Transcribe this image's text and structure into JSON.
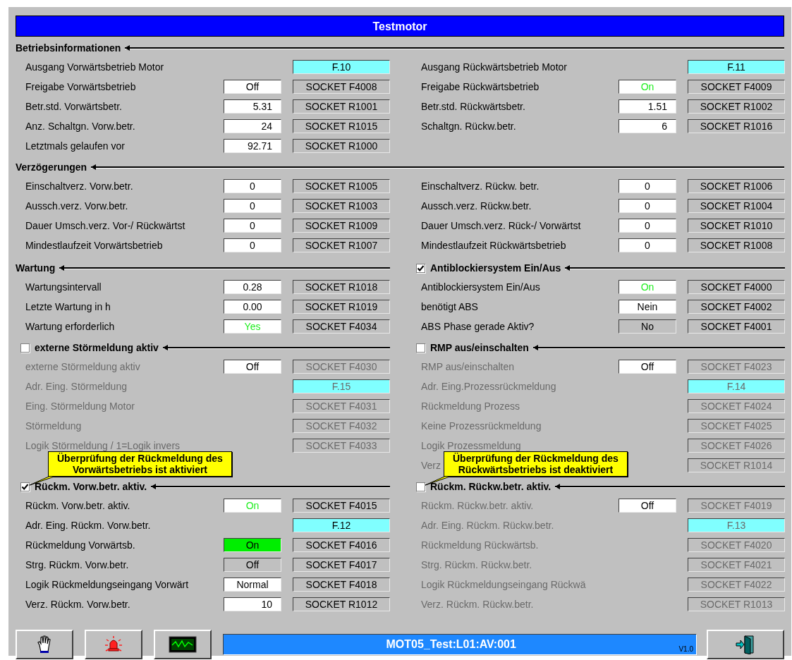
{
  "title": "Testmotor",
  "wide_sections": [
    {
      "title": "Betriebsinformationen",
      "left": [
        {
          "label": "Ausgang Vorwärtsbetrieb Motor",
          "disabled": false,
          "field": {
            "kind": "address",
            "text": "F.10"
          }
        },
        {
          "label": "Freigabe Vorwärtsbetrieb",
          "disabled": false,
          "value": {
            "kind": "text",
            "text": "Off"
          },
          "field": {
            "kind": "socket",
            "text": "SOCKET F4008"
          }
        },
        {
          "label": "Betr.std. Vorwärtsbetr.",
          "disabled": false,
          "value": {
            "kind": "number",
            "text": "5.31"
          },
          "field": {
            "kind": "socket",
            "text": "SOCKET R1001"
          }
        },
        {
          "label": "Anz. Schaltgn. Vorw.betr.",
          "disabled": false,
          "value": {
            "kind": "number",
            "text": "24"
          },
          "field": {
            "kind": "socket",
            "text": "SOCKET R1015"
          }
        },
        {
          "label": "Letztmals gelaufen vor",
          "disabled": false,
          "value": {
            "kind": "number",
            "text": "92.71"
          },
          "field": {
            "kind": "socket",
            "text": "SOCKET R1000"
          }
        }
      ],
      "right": [
        {
          "label": "Ausgang Rückwärtsbetrieb Motor",
          "disabled": false,
          "field": {
            "kind": "address",
            "text": "F.11"
          }
        },
        {
          "label": "Freigabe Rückwärtsbetrieb",
          "disabled": false,
          "value": {
            "kind": "on",
            "text": "On"
          },
          "field": {
            "kind": "socket",
            "text": "SOCKET F4009"
          }
        },
        {
          "label": "Betr.std. Rückwärtsbetr.",
          "disabled": false,
          "value": {
            "kind": "number",
            "text": "1.51"
          },
          "field": {
            "kind": "socket",
            "text": "SOCKET R1002"
          }
        },
        {
          "label": "Schaltgn. Rückw.betr.",
          "disabled": false,
          "value": {
            "kind": "number",
            "text": "6"
          },
          "field": {
            "kind": "socket",
            "text": "SOCKET R1016"
          }
        }
      ]
    },
    {
      "title": "Verzögerungen",
      "left": [
        {
          "label": "Einschaltverz. Vorw.betr.",
          "disabled": false,
          "value": {
            "kind": "text",
            "text": "0"
          },
          "field": {
            "kind": "socket",
            "text": "SOCKET R1005"
          }
        },
        {
          "label": "Aussch.verz. Vorw.betr.",
          "disabled": false,
          "value": {
            "kind": "text",
            "text": "0"
          },
          "field": {
            "kind": "socket",
            "text": "SOCKET R1003"
          }
        },
        {
          "label": "Dauer Umsch.verz. Vor-/ Rückwärtst",
          "disabled": false,
          "value": {
            "kind": "text",
            "text": "0"
          },
          "field": {
            "kind": "socket",
            "text": "SOCKET R1009"
          }
        },
        {
          "label": "Mindestlaufzeit Vorwärtsbetrieb",
          "disabled": false,
          "value": {
            "kind": "text",
            "text": "0"
          },
          "field": {
            "kind": "socket",
            "text": "SOCKET R1007"
          }
        }
      ],
      "right": [
        {
          "label": "Einschaltverz. Rückw. betr.",
          "disabled": false,
          "value": {
            "kind": "text",
            "text": "0"
          },
          "field": {
            "kind": "socket",
            "text": "SOCKET R1006"
          }
        },
        {
          "label": "Aussch.verz. Rückw.betr.",
          "disabled": false,
          "value": {
            "kind": "text",
            "text": "0"
          },
          "field": {
            "kind": "socket",
            "text": "SOCKET R1004"
          }
        },
        {
          "label": "Dauer Umsch.verz. Rück-/ Vorwärtst",
          "disabled": false,
          "value": {
            "kind": "text",
            "text": "0"
          },
          "field": {
            "kind": "socket",
            "text": "SOCKET R1010"
          }
        },
        {
          "label": "Mindestlaufzeit Rückwärtsbetrieb",
          "disabled": false,
          "value": {
            "kind": "text",
            "text": "0"
          },
          "field": {
            "kind": "socket",
            "text": "SOCKET R1008"
          }
        }
      ]
    }
  ],
  "left_sections": [
    {
      "title": "Wartung",
      "rows": [
        {
          "label": "Wartungsintervall",
          "disabled": false,
          "value": {
            "kind": "text",
            "text": "0.28"
          },
          "field": {
            "kind": "socket",
            "text": "SOCKET R1018"
          }
        },
        {
          "label": "Letzte Wartung in h",
          "disabled": false,
          "value": {
            "kind": "text",
            "text": "0.00"
          },
          "field": {
            "kind": "socket",
            "text": "SOCKET R1019"
          }
        },
        {
          "label": "Wartung erforderlich",
          "disabled": false,
          "value": {
            "kind": "on",
            "text": "Yes"
          },
          "field": {
            "kind": "socket",
            "text": "SOCKET F4034"
          }
        }
      ]
    },
    {
      "title": "externe Störmeldung aktiv",
      "checkbox": {
        "checked": false
      },
      "rows": [
        {
          "label": "externe Störmeldung aktiv",
          "disabled": true,
          "value": {
            "kind": "text",
            "text": "Off"
          },
          "field": {
            "kind": "socket",
            "text": "SOCKET F4030"
          }
        },
        {
          "label": "Adr. Eing. Störmeldung",
          "disabled": true,
          "field": {
            "kind": "address",
            "text": "F.15"
          }
        },
        {
          "label": "Eing. Störmeldung Motor",
          "disabled": true,
          "field": {
            "kind": "socket",
            "text": "SOCKET F4031"
          }
        },
        {
          "label": "Störmeldung",
          "disabled": true,
          "field": {
            "kind": "socket",
            "text": "SOCKET F4032"
          }
        },
        {
          "label": "Logik Störmeldung / 1=Logik invers",
          "disabled": true,
          "field": {
            "kind": "socket",
            "text": "SOCKET F4033"
          }
        }
      ]
    },
    {
      "title": "Rückm. Vorw.betr. aktiv.",
      "checkbox": {
        "checked": true
      },
      "callout": "Überprüfung der Rückmeldung des\nVorwärtsbetriebs ist aktiviert",
      "rows": [
        {
          "label": "Rückm. Vorw.betr. aktiv.",
          "disabled": false,
          "value": {
            "kind": "on",
            "text": "On"
          },
          "field": {
            "kind": "socket",
            "text": "SOCKET F4015"
          }
        },
        {
          "label": "Adr. Eing. Rückm. Vorw.betr.",
          "disabled": false,
          "field": {
            "kind": "address",
            "text": "F.12"
          }
        },
        {
          "label": "Rückmeldung Vorwärtsb.",
          "disabled": false,
          "value": {
            "kind": "active",
            "text": "On"
          },
          "field": {
            "kind": "socket",
            "text": "SOCKET F4016"
          }
        },
        {
          "label": "Strg. Rückm. Vorw.betr.",
          "disabled": false,
          "value": {
            "kind": "readonly",
            "text": "Off"
          },
          "field": {
            "kind": "socket",
            "text": "SOCKET F4017"
          }
        },
        {
          "label": "Logik Rückmeldungseingang Vorwärt",
          "disabled": false,
          "value": {
            "kind": "text",
            "text": "Normal"
          },
          "field": {
            "kind": "socket",
            "text": "SOCKET F4018"
          }
        },
        {
          "label": "Verz. Rückm. Vorw.betr.",
          "disabled": false,
          "value": {
            "kind": "number",
            "text": "10"
          },
          "field": {
            "kind": "socket",
            "text": "SOCKET R1012"
          }
        }
      ]
    }
  ],
  "right_sections": [
    {
      "title": "Antiblockiersystem Ein/Aus",
      "checkbox": {
        "checked": true
      },
      "rows": [
        {
          "label": "Antiblockiersystem Ein/Aus",
          "disabled": false,
          "value": {
            "kind": "on",
            "text": "On"
          },
          "field": {
            "kind": "socket",
            "text": "SOCKET F4000"
          }
        },
        {
          "label": "benötigt ABS",
          "disabled": false,
          "value": {
            "kind": "text",
            "text": "Nein"
          },
          "field": {
            "kind": "socket",
            "text": "SOCKET F4002"
          }
        },
        {
          "label": "ABS Phase gerade Aktiv?",
          "disabled": false,
          "value": {
            "kind": "readonly",
            "text": "No"
          },
          "field": {
            "kind": "socket",
            "text": "SOCKET F4001"
          }
        }
      ]
    },
    {
      "title": "RMP aus/einschalten",
      "checkbox": {
        "checked": false
      },
      "rows": [
        {
          "label": "RMP aus/einschalten",
          "disabled": true,
          "value": {
            "kind": "text",
            "text": "Off"
          },
          "field": {
            "kind": "socket",
            "text": "SOCKET F4023"
          }
        },
        {
          "label": "Adr. Eing.Prozessrückmeldung",
          "disabled": true,
          "field": {
            "kind": "address",
            "text": "F.14"
          }
        },
        {
          "label": "Rückmeldung Prozess",
          "disabled": true,
          "field": {
            "kind": "socket",
            "text": "SOCKET F4024"
          }
        },
        {
          "label": "Keine Prozessrückmeldung",
          "disabled": true,
          "field": {
            "kind": "socket",
            "text": "SOCKET F4025"
          }
        },
        {
          "label": "Logik Prozessmeldung",
          "disabled": true,
          "field": {
            "kind": "socket",
            "text": "SOCKET F4026"
          }
        },
        {
          "label": "Verz",
          "disabled": true,
          "field": {
            "kind": "socket",
            "text": "SOCKET R1014"
          }
        }
      ]
    },
    {
      "title": "Rückm. Rückw.betr. aktiv.",
      "checkbox": {
        "checked": false
      },
      "callout": "Überprüfung der Rückmeldung des\nRückwärtsbetriebs ist deaktiviert",
      "rows": [
        {
          "label": "Rückm. Rückw.betr. aktiv.",
          "disabled": true,
          "value": {
            "kind": "text",
            "text": "Off"
          },
          "field": {
            "kind": "socket",
            "text": "SOCKET F4019"
          }
        },
        {
          "label": "Adr. Eing. Rückm. Rückw.betr.",
          "disabled": true,
          "field": {
            "kind": "address",
            "text": "F.13"
          }
        },
        {
          "label": "Rückmeldung Rückwärtsb.",
          "disabled": true,
          "field": {
            "kind": "socket",
            "text": "SOCKET F4020"
          }
        },
        {
          "label": "Strg. Rückm. Rückw.betr.",
          "disabled": true,
          "field": {
            "kind": "socket",
            "text": "SOCKET F4021"
          }
        },
        {
          "label": "Logik Rückmeldungseingang Rückwä",
          "disabled": true,
          "field": {
            "kind": "socket",
            "text": "SOCKET F4022"
          }
        },
        {
          "label": "Verz. Rückm. Rückw.betr.",
          "disabled": true,
          "field": {
            "kind": "socket",
            "text": "SOCKET R1013"
          }
        }
      ]
    }
  ],
  "footer": {
    "status": "MOT05_Test:L01:AV:001",
    "version": "V1.0"
  }
}
